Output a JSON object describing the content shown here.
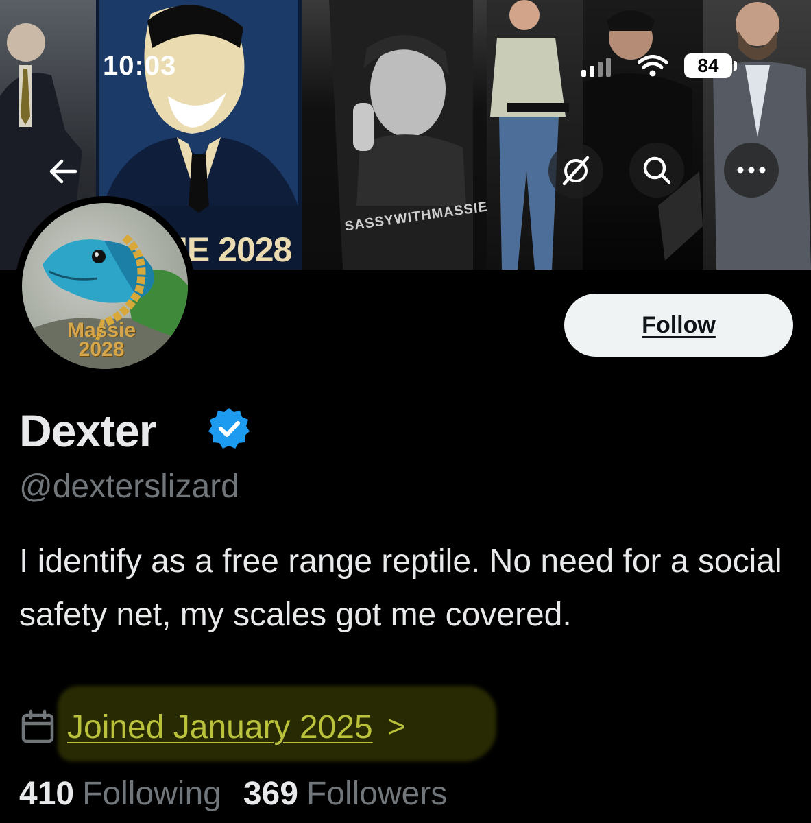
{
  "status_bar": {
    "time": "10:03",
    "battery": "84"
  },
  "banner": {
    "poster_caption": "IE 2028",
    "shirt_caption": "SASSYWITHMASSIE"
  },
  "avatar": {
    "caption_line1": "Massie",
    "caption_line2": "2028"
  },
  "actions": {
    "follow_label": "Follow"
  },
  "profile": {
    "display_name": "Dexter",
    "handle": "@dexterslizard",
    "bio": "I identify as a free range reptile. No need for a social safety net, my scales got me covered.",
    "joined": "Joined January 2025",
    "following_count": "410",
    "following_label": "Following",
    "followers_count": "369",
    "followers_label": "Followers"
  },
  "colors": {
    "background": "#000000",
    "verified_blue": "#1d9bf0",
    "muted_text": "#71767b",
    "highlight_yellow": "#b9c23a"
  },
  "icons": [
    "back-arrow-icon",
    "grok-icon",
    "search-icon",
    "more-icon",
    "calendar-icon",
    "chevron-right-icon",
    "verified-badge-icon"
  ]
}
